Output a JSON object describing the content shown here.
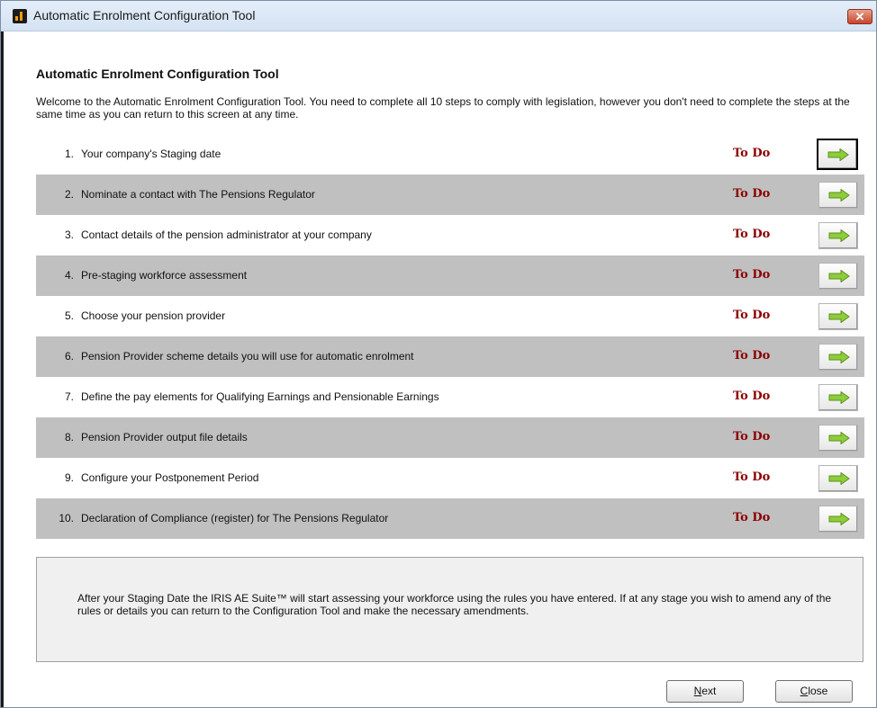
{
  "window": {
    "title": "Automatic Enrolment Configuration Tool",
    "close_glyph": "✕"
  },
  "header": {
    "title": "Automatic Enrolment Configuration Tool"
  },
  "intro": "Welcome to the Automatic Enrolment Configuration Tool.  You need to complete all 10 steps to comply with legislation, however you don't need to complete the steps at the same time as you can return to this screen at any time.",
  "steps": [
    {
      "num": "1.",
      "label": "Your company's Staging date",
      "status": "To Do"
    },
    {
      "num": "2.",
      "label": "Nominate a contact with The Pensions Regulator",
      "status": "To Do"
    },
    {
      "num": "3.",
      "label": "Contact details of the pension administrator at your company",
      "status": "To Do"
    },
    {
      "num": "4.",
      "label": "Pre-staging workforce assessment",
      "status": "To Do"
    },
    {
      "num": "5.",
      "label": "Choose your pension provider",
      "status": "To Do"
    },
    {
      "num": "6.",
      "label": "Pension Provider scheme details you will use for automatic enrolment",
      "status": "To Do"
    },
    {
      "num": "7.",
      "label": "Define the pay elements for Qualifying Earnings and Pensionable Earnings",
      "status": "To Do"
    },
    {
      "num": "8.",
      "label": "Pension Provider output file details",
      "status": "To Do"
    },
    {
      "num": "9.",
      "label": "Configure your Postponement Period",
      "status": "To Do"
    },
    {
      "num": "10.",
      "label": "Declaration of Compliance (register) for The Pensions Regulator",
      "status": "To Do"
    }
  ],
  "footer": {
    "text": "After your Staging Date the IRIS AE Suite™ will start assessing your workforce using the rules you have entered.  If at any stage you wish to amend any of the rules or details you can return to the Configuration Tool and make the necessary amendments."
  },
  "buttons": {
    "next_first": "N",
    "next_rest": "ext",
    "close_first": "C",
    "close_rest": "lose"
  },
  "colors": {
    "status": "#8b0000",
    "arrow_fill": "#8ccd3a",
    "row_shade": "#c0c0c0"
  },
  "icons": {
    "step_arrow": "right-arrow-icon",
    "app": "iris-app-icon"
  }
}
